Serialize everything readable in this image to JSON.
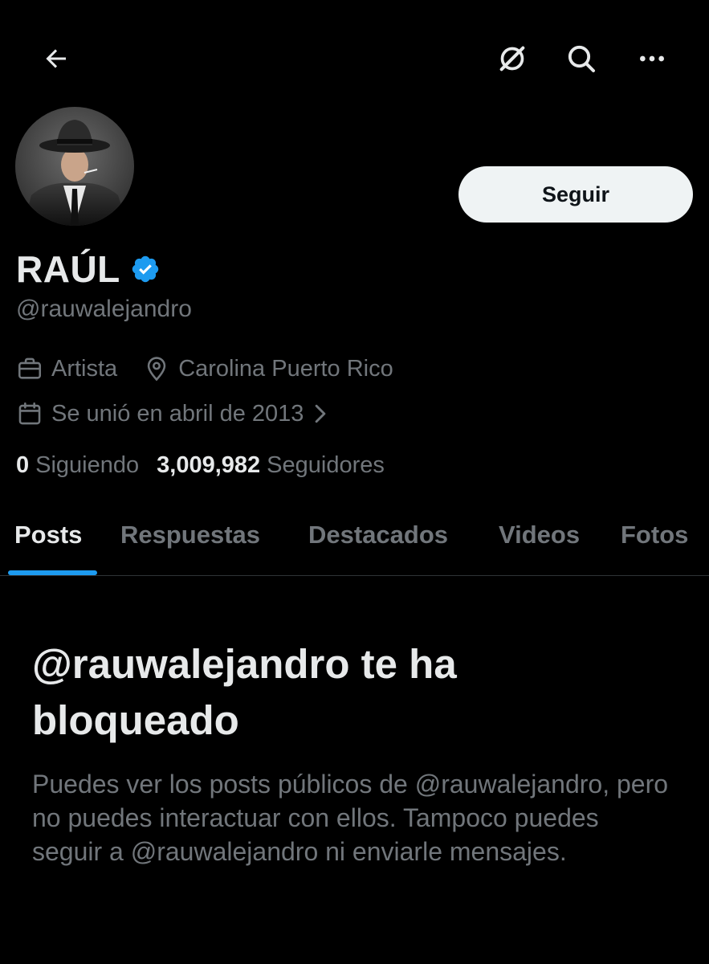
{
  "header": {
    "icons": [
      "back-arrow-icon",
      "grok-icon",
      "search-icon",
      "more-icon"
    ]
  },
  "profile": {
    "display_name": "RAÚL",
    "verified": true,
    "verified_color": "#1d9bf0",
    "handle": "@rauwalejandro",
    "follow_button_label": "Seguir",
    "profession": "Artista",
    "location": "Carolina Puerto Rico",
    "joined": "Se unió en abril de 2013",
    "following_count": "0",
    "following_label": "Siguiendo",
    "followers_count": "3,009,982",
    "followers_label": "Seguidores"
  },
  "tabs": [
    {
      "label": "Posts",
      "active": true
    },
    {
      "label": "Respuestas",
      "active": false
    },
    {
      "label": "Destacados",
      "active": false
    },
    {
      "label": "Videos",
      "active": false
    },
    {
      "label": "Fotos",
      "active": false
    }
  ],
  "blocked_notice": {
    "title": "@rauwalejandro te ha bloqueado",
    "body": "Puedes ver los posts públicos de @rauwalejandro, pero no puedes interactuar con ellos. Tampoco puedes seguir a @rauwalejandro ni enviarle mensajes."
  },
  "colors": {
    "background": "#000000",
    "primary_text": "#e7e9ea",
    "secondary_text": "#71767b",
    "accent": "#1d9bf0",
    "button_bg": "#eff3f4"
  }
}
